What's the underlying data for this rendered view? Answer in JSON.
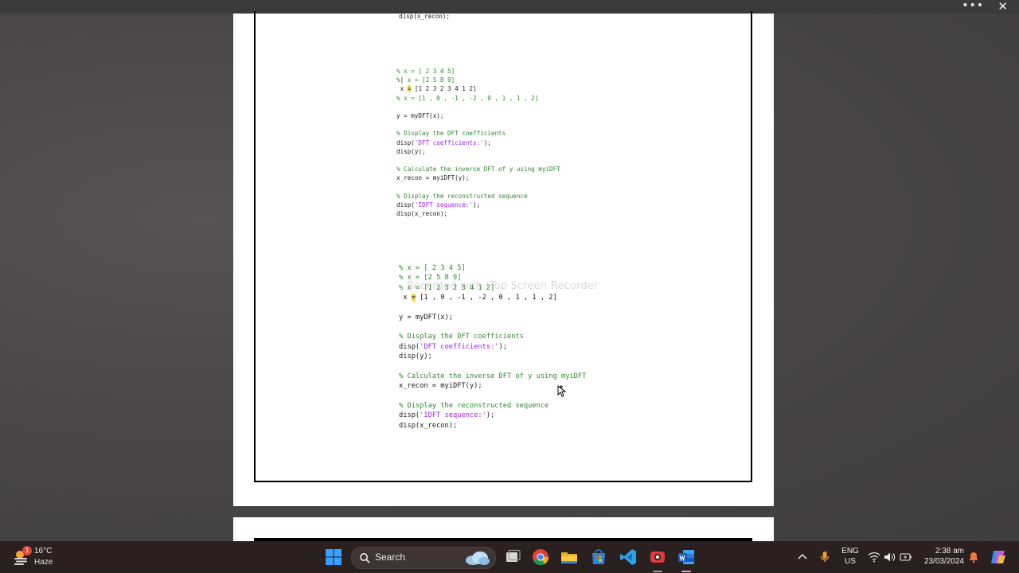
{
  "window": {
    "more_label": "•••",
    "close_label": "✕"
  },
  "document": {
    "top_fragment": [
      [
        {
          "t": "disp(x_recon);",
          "k": ""
        }
      ]
    ],
    "block1": [
      [
        {
          "t": "% x = [ 2 3 4 5]",
          "k": "c"
        }
      ],
      [
        {
          "t": "%",
          "k": "c"
        },
        {
          "t": "|",
          "k": ""
        },
        {
          "t": " x = [2 5 8 9]",
          "k": "c"
        }
      ],
      [
        {
          "t": " x ",
          "k": ""
        },
        {
          "t": "=",
          "k": "hl"
        },
        {
          "t": " [1 2 3 2 3 4 1 2]",
          "k": ""
        }
      ],
      [
        {
          "t": "% x = [1 , 0 , -1 , -2 , 0 , 1 , 1 , 2]",
          "k": "c"
        }
      ],
      [
        {
          "t": "",
          "k": ""
        }
      ],
      [
        {
          "t": "y = myDFT(x);",
          "k": ""
        }
      ],
      [
        {
          "t": "",
          "k": ""
        }
      ],
      [
        {
          "t": "% Display the DFT coefficients",
          "k": "c"
        }
      ],
      [
        {
          "t": "disp(",
          "k": ""
        },
        {
          "t": "'DFT coefficients:'",
          "k": "s"
        },
        {
          "t": ");",
          "k": ""
        }
      ],
      [
        {
          "t": "disp(y);",
          "k": ""
        }
      ],
      [
        {
          "t": "",
          "k": ""
        }
      ],
      [
        {
          "t": "% Calculate the inverse DFT of y using myiDFT",
          "k": "c"
        }
      ],
      [
        {
          "t": "x_recon = myiDFT(y);",
          "k": ""
        }
      ],
      [
        {
          "t": "",
          "k": ""
        }
      ],
      [
        {
          "t": "% Display the reconstructed sequence",
          "k": "c"
        }
      ],
      [
        {
          "t": "disp(",
          "k": ""
        },
        {
          "t": "'IDFT sequence:'",
          "k": "s"
        },
        {
          "t": ");",
          "k": ""
        }
      ],
      [
        {
          "t": "disp(x_recon);",
          "k": ""
        }
      ]
    ],
    "block2": [
      [
        {
          "t": "% x = [ 2 3 4 5]",
          "k": "c"
        }
      ],
      [
        {
          "t": "% x = [2 5 8 9]",
          "k": "c"
        }
      ],
      [
        {
          "t": "% x = [1 2 3 2 3 4 1 2]",
          "k": "c"
        }
      ],
      [
        {
          "t": " x ",
          "k": ""
        },
        {
          "t": "=",
          "k": "hl"
        },
        {
          "t": " [1 , 0 , -1 , -2 , 0 , 1 , 1 , 2]",
          "k": ""
        }
      ],
      [
        {
          "t": "",
          "k": ""
        }
      ],
      [
        {
          "t": "y = myDFT(x);",
          "k": ""
        }
      ],
      [
        {
          "t": "",
          "k": ""
        }
      ],
      [
        {
          "t": "% Display the DFT coefficients",
          "k": "c"
        }
      ],
      [
        {
          "t": "disp(",
          "k": ""
        },
        {
          "t": "'DFT coefficients:'",
          "k": "s"
        },
        {
          "t": ");",
          "k": ""
        }
      ],
      [
        {
          "t": "disp(y);",
          "k": ""
        }
      ],
      [
        {
          "t": "",
          "k": ""
        }
      ],
      [
        {
          "t": "% Calculate the inverse DFT of y using myiDFT",
          "k": "c"
        }
      ],
      [
        {
          "t": "x_recon = myiDFT(y);",
          "k": ""
        }
      ],
      [
        {
          "t": "",
          "k": ""
        }
      ],
      [
        {
          "t": "% Display the reconstructed sequence",
          "k": "c"
        }
      ],
      [
        {
          "t": "disp(",
          "k": ""
        },
        {
          "t": "'IDFT sequence:'",
          "k": "s"
        },
        {
          "t": ");",
          "k": ""
        }
      ],
      [
        {
          "t": "disp(x_recon);",
          "k": ""
        }
      ]
    ],
    "watermark": "Recorded with iTop Screen Recorder"
  },
  "taskbar": {
    "weather": {
      "temp": "16°C",
      "condition": "Haze",
      "badge": "1"
    },
    "search_label": "Search",
    "apps": [
      "start-icon",
      "task-view-icon",
      "chrome-icon",
      "file-explorer-icon",
      "store-icon",
      "vscode-icon",
      "screen-recorder-icon",
      "word-icon"
    ],
    "lang_top": "ENG",
    "lang_bottom": "US",
    "time": "2:38 am",
    "date": "23/03/2024",
    "colors": {
      "taskbar": "#2b2020",
      "comment": "#2e8b2e",
      "string": "#a020f0",
      "highlight": "#f5e14a"
    }
  }
}
